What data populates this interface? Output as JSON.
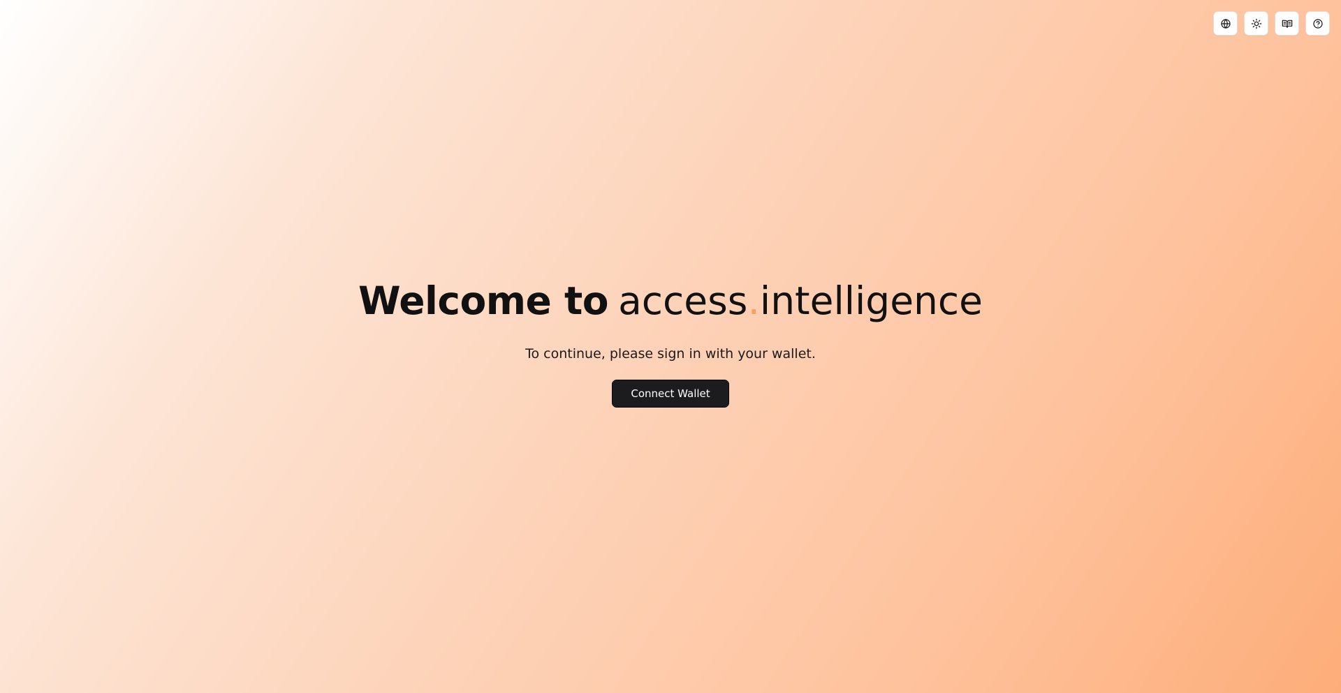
{
  "toolbar": {
    "items": [
      {
        "icon": "globe-icon"
      },
      {
        "icon": "sun-icon"
      },
      {
        "icon": "book-open-icon"
      },
      {
        "icon": "help-circle-icon"
      }
    ]
  },
  "hero": {
    "title_prefix": "Welcome to",
    "brand_part1": "access",
    "brand_dot": ".",
    "brand_part2": "intelligence",
    "subtitle": "To continue, please sign in with your wallet.",
    "connect_button_label": "Connect Wallet"
  },
  "colors": {
    "accent": "#fb9f63",
    "button_background": "#1c1c1e",
    "button_text": "#ffffff",
    "text": "#111111"
  }
}
